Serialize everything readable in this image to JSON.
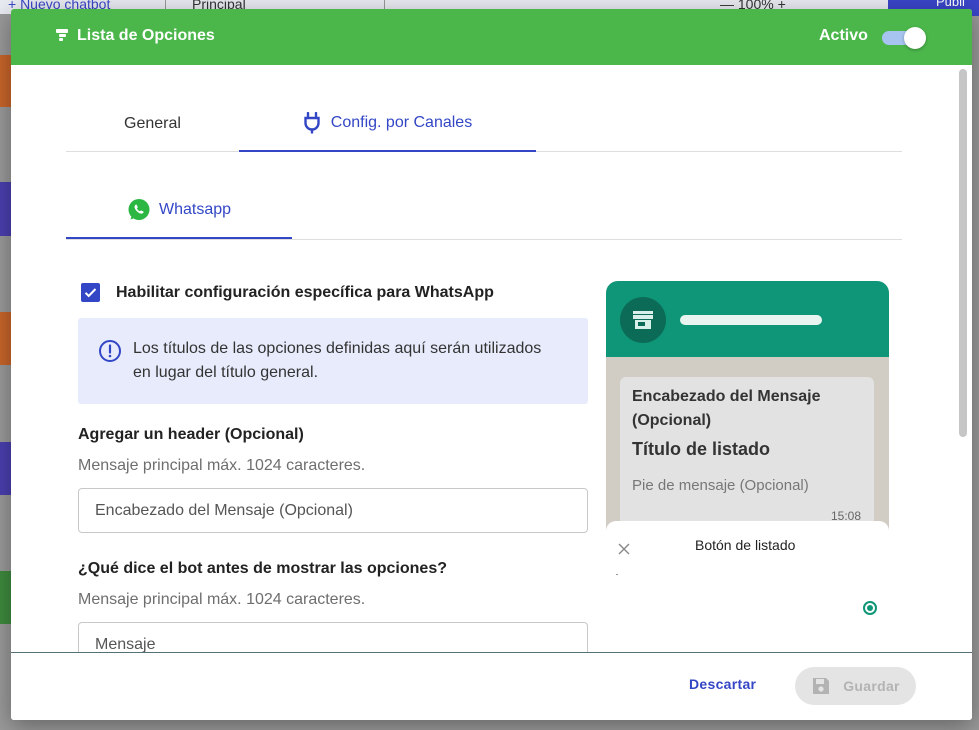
{
  "background": {
    "new_chatbot": "+  Nuevo chatbot",
    "flow_select": "Principal",
    "zoom": "— 100% +",
    "publish": "Publi"
  },
  "modal": {
    "title": "Lista de Opciones",
    "active_label": "Activo",
    "active": true,
    "colors": {
      "header": "#4bb74b",
      "accent": "#3347c6",
      "whatsapp": "#0f9678"
    }
  },
  "tabs": [
    {
      "label": "General",
      "active": false
    },
    {
      "label": "Config. por Canales",
      "active": true,
      "icon": "plug-icon"
    }
  ],
  "channel_tabs": [
    {
      "label": "Whatsapp",
      "active": true,
      "icon": "whatsapp-icon"
    }
  ],
  "form": {
    "enable_label": "Habilitar configuración específica para WhatsApp",
    "enable_checked": true,
    "info_text": "Los títulos de las opciones definidas aquí serán utilizados en lugar del título general.",
    "header_label": "Agregar un header (Opcional)",
    "header_help": "Mensaje principal máx. 1024 caracteres.",
    "header_placeholder": "Encabezado del Mensaje (Opcional)",
    "message_label": "¿Qué dice el bot antes de mostrar las opciones?",
    "message_help": "Mensaje principal máx. 1024 caracteres.",
    "message_placeholder": "Mensaje"
  },
  "preview": {
    "header": "Encabezado del Mensaje (Opcional)",
    "title": "Título de listado",
    "footer": "Pie de mensaje (Opcional)",
    "time": "15:08",
    "sheet_title": "Botón de listado"
  },
  "footer": {
    "discard": "Descartar",
    "save": "Guardar"
  }
}
